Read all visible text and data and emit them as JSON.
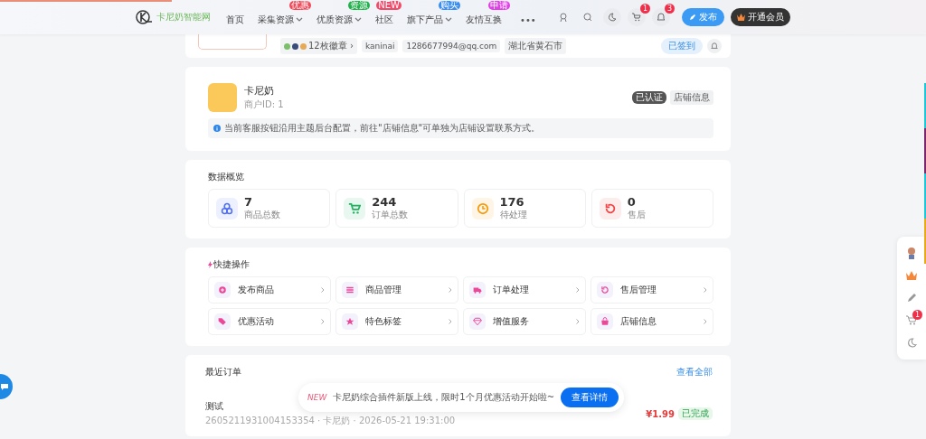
{
  "header": {
    "logo_text": "卡尼奶智能网",
    "nav": [
      {
        "label": "首页",
        "dropdown": false
      },
      {
        "label": "采集资源",
        "badge": {
          "text": "优惠",
          "color": "#f04b5a"
        },
        "dropdown": true
      },
      {
        "label": "优质资源",
        "badge": {
          "text": "资源",
          "color": "#22b14c"
        },
        "dropdown": true
      },
      {
        "label": "社区",
        "badge": {
          "text": "NEW",
          "color": "#f04b6a"
        },
        "dropdown": false
      },
      {
        "label": "旗下产品",
        "badge": {
          "text": "购买",
          "color": "#3a8ef0"
        },
        "dropdown": true
      },
      {
        "label": "友情互换",
        "badge": {
          "text": "申请",
          "color": "#e040e6"
        },
        "dropdown": false
      }
    ],
    "more": "•••",
    "cart_count": "1",
    "notice_count": "3",
    "publish": "发布",
    "vip": "开通会员"
  },
  "profile": {
    "badges": "12枚徽章 ›",
    "username": "kaninai",
    "email": "1286677994@qq.com",
    "location": "湖北省黄石市",
    "checkin": "已签到"
  },
  "store": {
    "name": "卡尼奶",
    "merchant_id": "商户ID: 1",
    "verified": "已认证",
    "edit": "店铺信息",
    "notice": "当前客服按钮沿用主题后台配置，前往\"店铺信息\"可单独为店铺设置联系方式。"
  },
  "overview": {
    "title": "数据概览",
    "stats": [
      {
        "kind": "products",
        "value": "7",
        "label": "商品总数",
        "color": "#4f6ef2"
      },
      {
        "kind": "orders",
        "value": "244",
        "label": "订单总数",
        "color": "#22b35e"
      },
      {
        "kind": "pending",
        "value": "176",
        "label": "待处理",
        "color": "#f59a0b"
      },
      {
        "kind": "aftersale",
        "value": "0",
        "label": "售后",
        "color": "#ef4444"
      }
    ]
  },
  "quick": {
    "title": "快捷操作",
    "actions": [
      {
        "kind": "add",
        "label": "发布商品"
      },
      {
        "kind": "list",
        "label": "商品管理"
      },
      {
        "kind": "truck",
        "label": "订单处理"
      },
      {
        "kind": "undo",
        "label": "售后管理"
      },
      {
        "kind": "tag",
        "label": "优惠活动"
      },
      {
        "kind": "star",
        "label": "特色标签"
      },
      {
        "kind": "gem",
        "label": "增值服务"
      },
      {
        "kind": "bag",
        "label": "店铺信息"
      }
    ]
  },
  "orders": {
    "title": "最近订单",
    "view_all": "查看全部",
    "rows": [
      {
        "name": "测试",
        "meta": "2605211931004153354 · 卡尼奶 · 2026-05-21 19:31:00",
        "price": "¥1.99",
        "status": "已完成"
      }
    ]
  },
  "toast": {
    "tag": "NEW",
    "text": "卡尼奶综合插件新版上线，限时1个月优惠活动开始啦~",
    "button": "查看详情"
  },
  "side_dock": {
    "cart_count": "1"
  }
}
